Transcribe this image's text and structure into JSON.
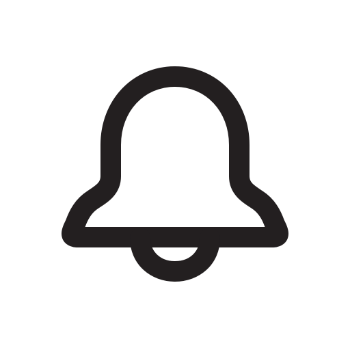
{
  "icon": {
    "name": "bell-icon",
    "stroke_color": "#231f20",
    "background_color": "#ffffff"
  }
}
